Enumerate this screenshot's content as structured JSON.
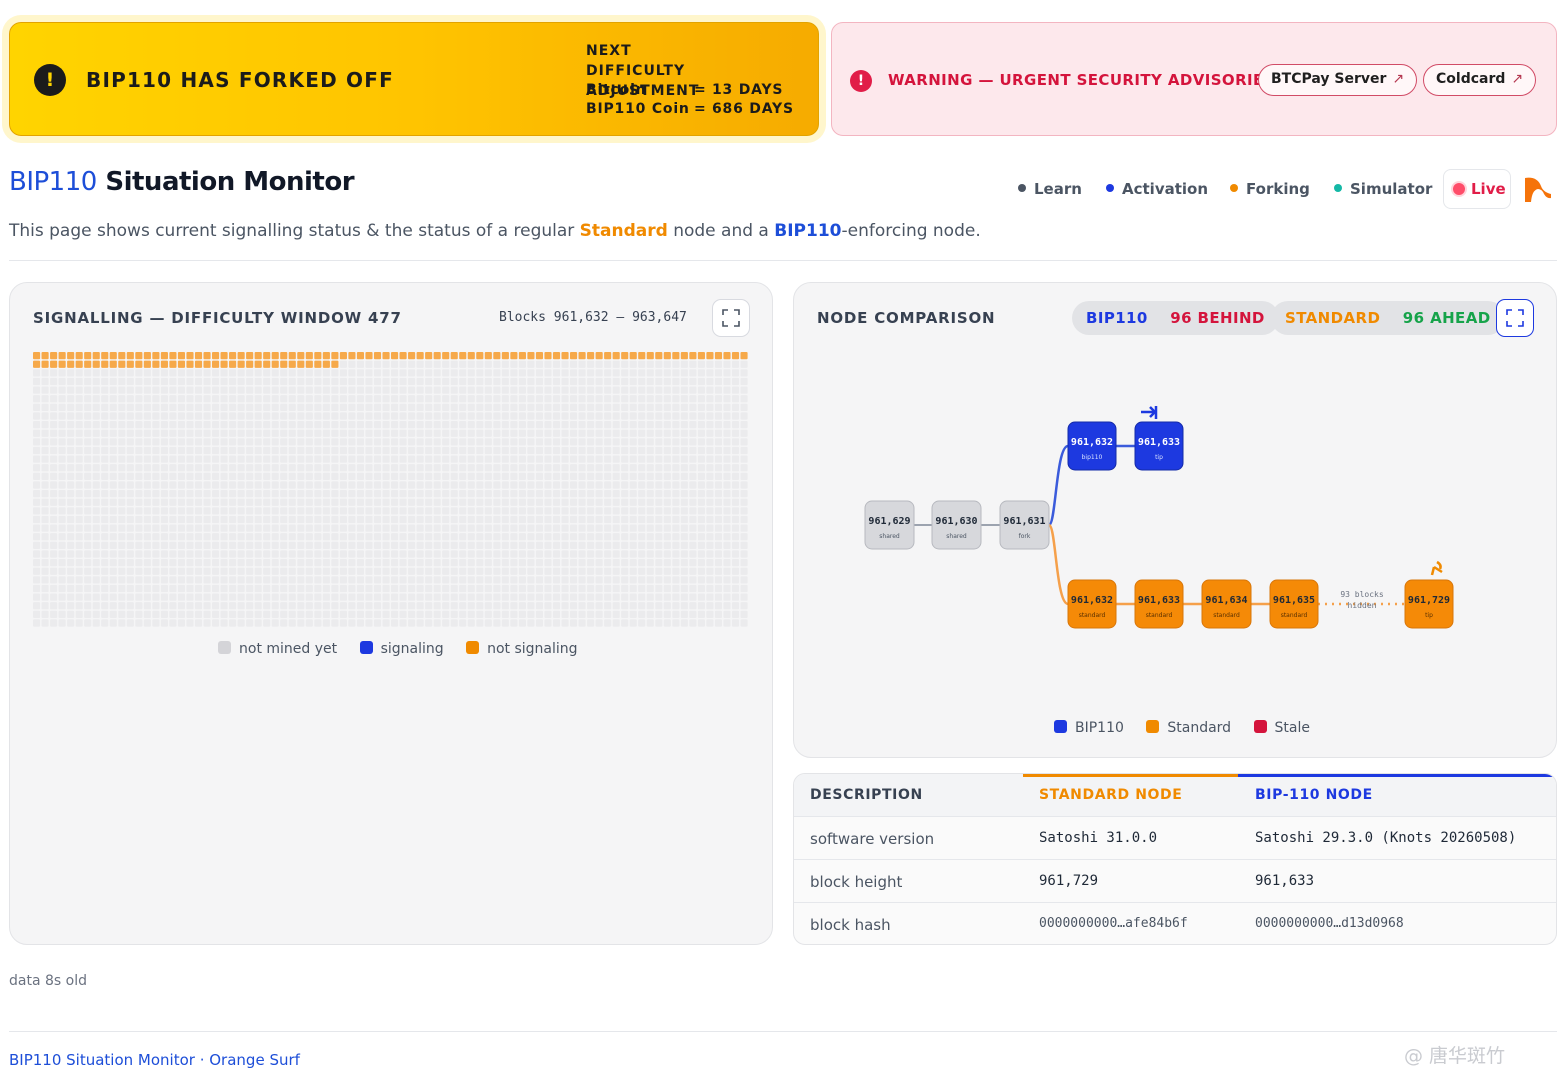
{
  "fork_banner": {
    "title": "BIP110 HAS FORKED OFF",
    "icon": "exclamation-icon",
    "next_label_line1": "NEXT DIFFICULTY",
    "next_label_line2": "ADJUSTMENT",
    "rows": [
      {
        "label": "Bitcoin",
        "eq": "=",
        "value": "13 DAYS"
      },
      {
        "label": "BIP110 Coin",
        "eq": "=",
        "value": "686 DAYS"
      }
    ]
  },
  "warning_banner": {
    "text": "WARNING — URGENT SECURITY ADVISORIES",
    "buttons": [
      {
        "label": "BTCPay Server",
        "arrow": "↗"
      },
      {
        "label": "Coldcard",
        "arrow": "↗"
      }
    ]
  },
  "header": {
    "title_prefix": "BIP110",
    "title_rest": " Situation Monitor",
    "subtitle_a": "This page shows current signalling status & the status of a regular ",
    "subtitle_std": "Standard",
    "subtitle_b": " node and a ",
    "subtitle_bip": "BIP110",
    "subtitle_c": "-enforcing node."
  },
  "nav": [
    {
      "label": "Learn",
      "color": "#4b5563"
    },
    {
      "label": "Activation",
      "color": "#1d39e0"
    },
    {
      "label": "Forking",
      "color": "#f08a00"
    },
    {
      "label": "Simulator",
      "color": "#14b8a6"
    }
  ],
  "live_label": "Live",
  "signalling": {
    "title": "SIGNALLING — DIFFICULTY WINDOW 477",
    "range_prefix": "Blocks",
    "range_start": "961,632",
    "range_sep": "–",
    "range_end": "963,647",
    "cols": 84,
    "rows": 32,
    "mined_not_signaling": 120,
    "legend": [
      {
        "label": "not mined yet",
        "color": "#d4d4d8"
      },
      {
        "label": "signaling",
        "color": "#1d39e0"
      },
      {
        "label": "not signaling",
        "color": "#f08a00"
      }
    ],
    "colors": {
      "empty": "#ebebed",
      "not_signaling": "#f6a94a",
      "signaling": "#1d39e0"
    }
  },
  "node_comparison": {
    "title": "NODE COMPARISON",
    "bip_pill": {
      "label": "BIP110",
      "status": "96 BEHIND"
    },
    "std_pill": {
      "label": "STANDARD",
      "status": "96 AHEAD"
    },
    "shared_blocks": [
      {
        "height": "961,629",
        "tag": "shared"
      },
      {
        "height": "961,630",
        "tag": "shared"
      },
      {
        "height": "961,631",
        "tag": "fork"
      }
    ],
    "bip_blocks": [
      {
        "height": "961,632",
        "tag": "bip110"
      },
      {
        "height": "961,633",
        "tag": "tip"
      }
    ],
    "std_blocks": [
      {
        "height": "961,632",
        "tag": "standard"
      },
      {
        "height": "961,633",
        "tag": "standard"
      },
      {
        "height": "961,634",
        "tag": "standard"
      },
      {
        "height": "961,635",
        "tag": "standard"
      },
      {
        "height": "961,729",
        "tag": "tip"
      }
    ],
    "hidden_line1": "93 blocks",
    "hidden_line2": "hidden",
    "legend": [
      {
        "label": "BIP110",
        "color": "#1d39e0"
      },
      {
        "label": "Standard",
        "color": "#f08a00"
      },
      {
        "label": "Stale",
        "color": "#d4143c"
      }
    ]
  },
  "table": {
    "headers": [
      "DESCRIPTION",
      "STANDARD NODE",
      "BIP-110 NODE"
    ],
    "rows": [
      {
        "desc": "software version",
        "std": "Satoshi 31.0.0",
        "bip": "Satoshi 29.3.0 (Knots 20260508)"
      },
      {
        "desc": "block height",
        "std": "961,729",
        "bip": "961,633"
      },
      {
        "desc": "block hash",
        "std": "0000000000…afe84b6f",
        "bip": "0000000000…d13d0968"
      }
    ]
  },
  "data_age": "data 8s old",
  "footer": "BIP110 Situation Monitor · Orange Surf",
  "watermark": "@ 唐华斑竹"
}
